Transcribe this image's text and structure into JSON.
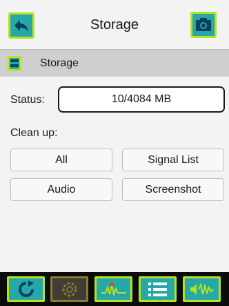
{
  "header": {
    "title": "Storage",
    "back_icon": "back-arrow-icon",
    "screenshot_icon": "camera-icon"
  },
  "section": {
    "label": "Storage",
    "icon": "storage-icon"
  },
  "status": {
    "label": "Status:",
    "value": "10/4084 MB"
  },
  "cleanup": {
    "label": "Clean up:",
    "buttons": {
      "all": "All",
      "signal_list": "Signal List",
      "audio": "Audio",
      "screenshot": "Screenshot"
    }
  },
  "bottom_nav": [
    {
      "icon": "refresh-icon"
    },
    {
      "icon": "gear-icon"
    },
    {
      "icon": "spectrum-icon"
    },
    {
      "icon": "list-icon"
    },
    {
      "icon": "audio-waveform-icon"
    }
  ],
  "colors": {
    "accent": "#27a8a8",
    "border_accent": "#b8e11e",
    "section_bg": "#cfcfcf",
    "bottom_bg": "#0c0c0c"
  }
}
